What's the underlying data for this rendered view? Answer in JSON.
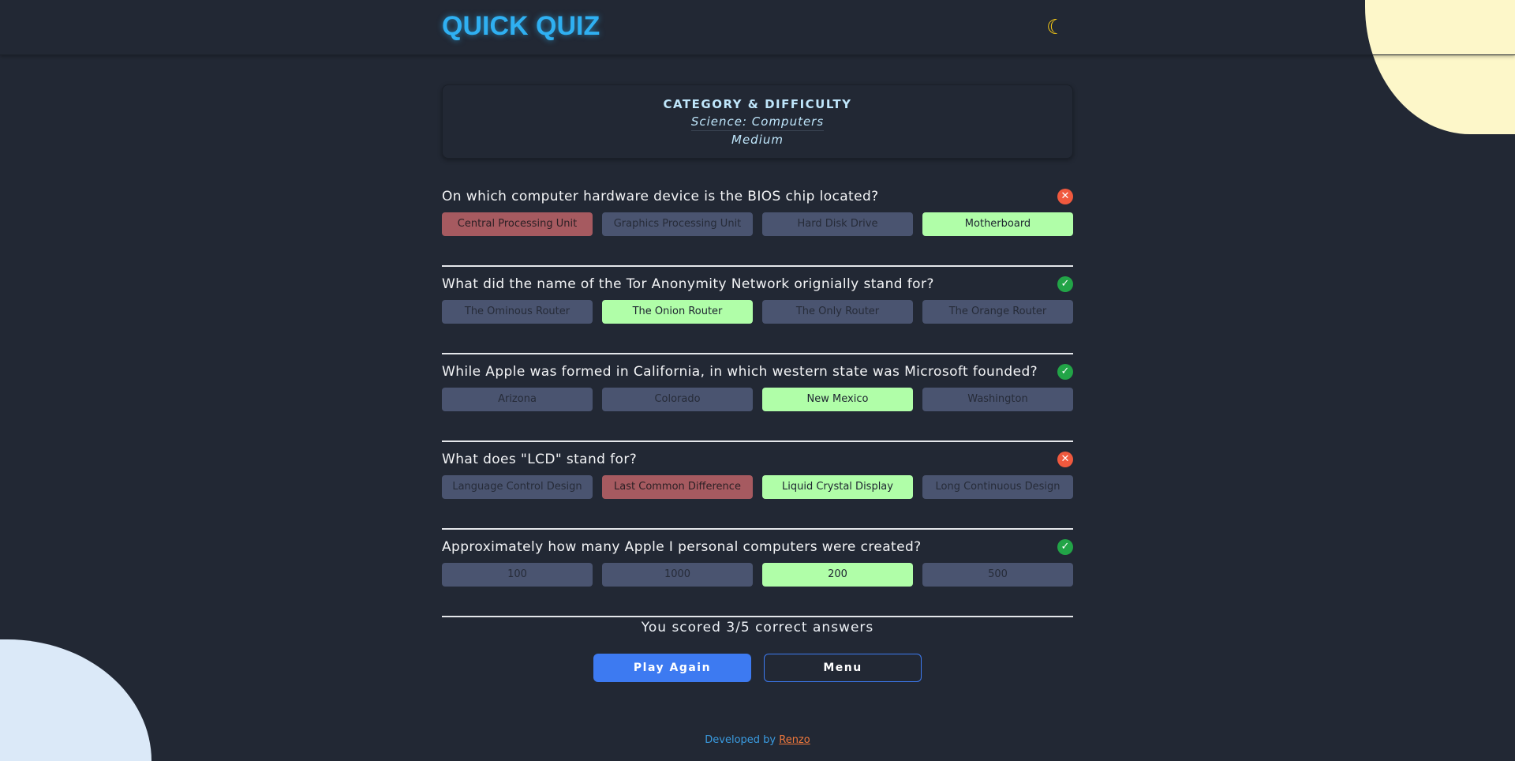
{
  "header": {
    "title": "QUICK QUIZ",
    "theme_icon": "moon-icon"
  },
  "category": {
    "heading": "CATEGORY & DIFFICULTY",
    "name": "Science: Computers",
    "difficulty": "Medium"
  },
  "colors": {
    "correct": "#b0fea8",
    "wrong": "#a65a60",
    "neutral": "#4a5470",
    "accent": "#3d7af1"
  },
  "questions": [
    {
      "text": "On which computer hardware device is the BIOS chip located?",
      "result": "incorrect",
      "answers": [
        "Central Processing Unit",
        "Graphics Processing Unit",
        "Hard Disk Drive",
        "Motherboard"
      ],
      "states": [
        "wrong",
        "",
        "",
        "correct"
      ]
    },
    {
      "text": "What did the name of the Tor Anonymity Network orignially stand for?",
      "result": "correct",
      "answers": [
        "The Ominous Router",
        "The Onion Router",
        "The Only Router",
        "The Orange Router"
      ],
      "states": [
        "",
        "correct",
        "",
        ""
      ]
    },
    {
      "text": "While Apple was formed in California, in which western state was Microsoft founded?",
      "result": "correct",
      "answers": [
        "Arizona",
        "Colorado",
        "New Mexico",
        "Washington"
      ],
      "states": [
        "",
        "",
        "correct",
        ""
      ]
    },
    {
      "text": "What does \"LCD\" stand for?",
      "result": "incorrect",
      "answers": [
        "Language Control Design",
        "Last Common Difference",
        "Liquid Crystal Display",
        "Long Continuous Design"
      ],
      "states": [
        "",
        "wrong",
        "correct",
        ""
      ]
    },
    {
      "text": "Approximately how many Apple I personal computers were created?",
      "result": "correct",
      "answers": [
        "100",
        "1000",
        "200",
        "500"
      ],
      "states": [
        "",
        "",
        "correct",
        ""
      ]
    }
  ],
  "score": "You scored 3/5 correct answers",
  "buttons": {
    "play_again": "Play Again",
    "menu": "Menu"
  },
  "footer": {
    "text": "Developed by ",
    "author": "Renzo"
  }
}
